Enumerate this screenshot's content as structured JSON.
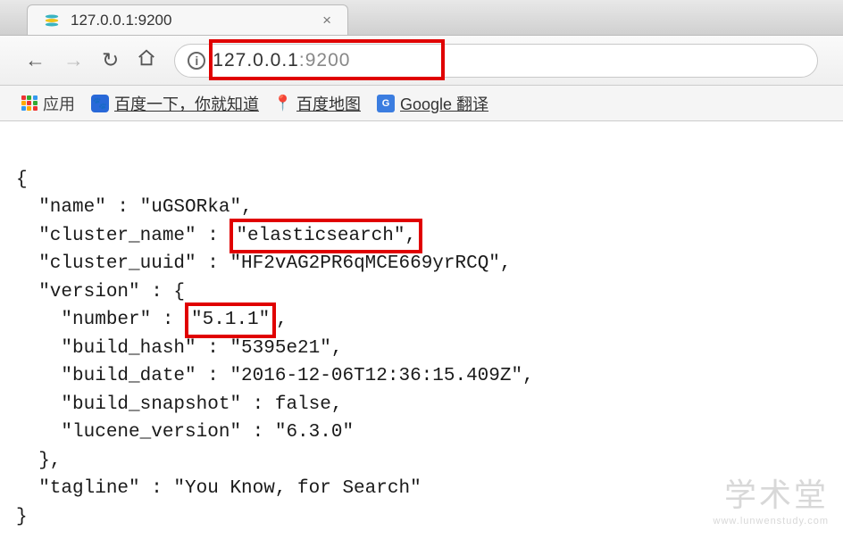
{
  "tab": {
    "title": "127.0.0.1:9200",
    "close": "×"
  },
  "address": {
    "host": "127.0.0.1",
    "port": ":9200"
  },
  "bookmarks": {
    "apps": "应用",
    "baidu": "百度一下，你就知道",
    "baidu_map": "百度地图",
    "gtranslate": "Google 翻译"
  },
  "json": {
    "open": "{",
    "name_key": "  \"name\" : ",
    "name_val": "\"uGSORka\",",
    "cluster_name_key": "  \"cluster_name\" : ",
    "cluster_name_val": "\"elasticsearch\",",
    "cluster_uuid_key": "  \"cluster_uuid\" : ",
    "cluster_uuid_val": "\"HF2vAG2PR6qMCE669yrRCQ\",",
    "version_key": "  \"version\" : {",
    "number_key": "    \"number\" : ",
    "number_val": "\"5.1.1\"",
    "number_comma": ",",
    "build_hash": "    \"build_hash\" : \"5395e21\",",
    "build_date": "    \"build_date\" : \"2016-12-06T12:36:15.409Z\",",
    "build_snapshot": "    \"build_snapshot\" : false,",
    "lucene_version": "    \"lucene_version\" : \"6.3.0\"",
    "version_close": "  },",
    "tagline": "  \"tagline\" : \"You Know, for Search\"",
    "close": "}"
  },
  "watermark": {
    "big": "学术堂",
    "small": "www.lunwenstudy.com"
  }
}
